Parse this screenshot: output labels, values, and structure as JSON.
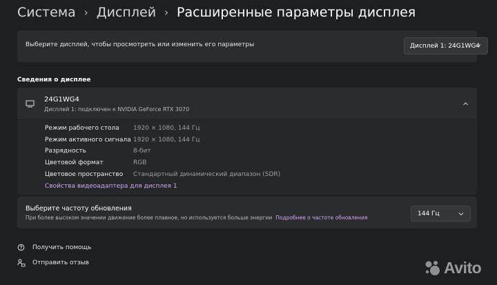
{
  "breadcrumb": {
    "items": [
      "Система",
      "Дисплей",
      "Расширенные параметры дисплея"
    ],
    "separator": "›"
  },
  "display_select": {
    "prompt": "Выберите дисплей, чтобы просмотреть или изменить его параметры",
    "selected": "Дисплей 1: 24G1WG4"
  },
  "info_section": {
    "title": "Сведения о дисплее",
    "monitor_name": "24G1WG4",
    "monitor_subtitle": "Дисплей 1: подключен к NVIDIA GeForce RTX 3070",
    "rows": [
      {
        "label": "Режим рабочего стола",
        "value": "1920 × 1080, 144 Гц"
      },
      {
        "label": "Режим активного сигнала",
        "value": "1920 × 1080, 144 Гц"
      },
      {
        "label": "Разрядность",
        "value": "8-бит"
      },
      {
        "label": "Цветовой формат",
        "value": "RGB"
      },
      {
        "label": "Цветовое пространство",
        "value": "Стандартный динамический диапазон (SDR)"
      }
    ],
    "adapter_link": "Свойства видеоадаптера для дисплея 1"
  },
  "refresh": {
    "title": "Выберите частоту обновления",
    "description": "При более высоком значении движение более плавное, но используется больше энергии",
    "link": "Подробнее о частоте обновления",
    "selected": "144 Гц"
  },
  "footer": {
    "help": "Получить помощь",
    "feedback": "Отправить отзыв"
  },
  "watermark": {
    "text": "Avito"
  },
  "colors": {
    "background": "#1c2022",
    "card": "#2a2d2f",
    "link": "#d4a4f0"
  },
  "icons": [
    "chevron-right-icon",
    "chevron-down-icon",
    "monitor-icon",
    "chevron-up-icon",
    "help-icon",
    "feedback-icon",
    "avito-logo"
  ]
}
